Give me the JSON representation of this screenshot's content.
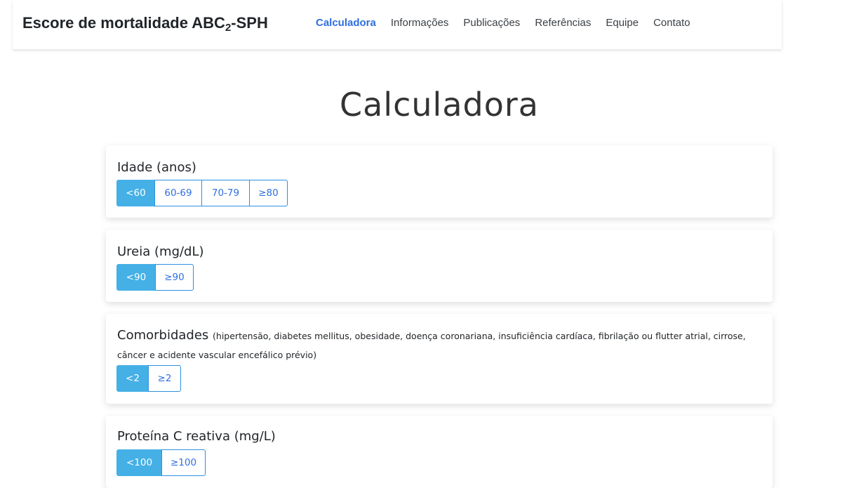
{
  "header": {
    "brand_prefix": "Escore de mortalidade ABC",
    "brand_sub": "2",
    "brand_suffix": "-SPH",
    "nav": [
      {
        "label": "Calculadora",
        "active": true
      },
      {
        "label": "Informações",
        "active": false
      },
      {
        "label": "Publicações",
        "active": false
      },
      {
        "label": "Referências",
        "active": false
      },
      {
        "label": "Equipe",
        "active": false
      },
      {
        "label": "Contato",
        "active": false
      }
    ]
  },
  "main": {
    "title": "Calculadora",
    "cards": [
      {
        "label": "Idade (anos)",
        "options": [
          "<60",
          "60-69",
          "70-79",
          "≥80"
        ],
        "selected": "<60"
      },
      {
        "label": "Ureia (mg/dL)",
        "options": [
          "<90",
          "≥90"
        ],
        "selected": "<90"
      },
      {
        "label": "Comorbidades",
        "note": "(hipertensão, diabetes mellitus, obesidade, doença coronariana, insuficiência cardíaca, fibrilação ou flutter atrial, cirrose, câncer e acidente vascular encefálico prévio)",
        "options": [
          "<2",
          "≥2"
        ],
        "selected": "<2"
      },
      {
        "label": "Proteína C reativa (mg/L)",
        "options": [
          "<100",
          "≥100"
        ],
        "selected": "<100"
      }
    ]
  },
  "colors": {
    "accent": "#2f6fe0",
    "selected_button": "#45b0e6"
  }
}
